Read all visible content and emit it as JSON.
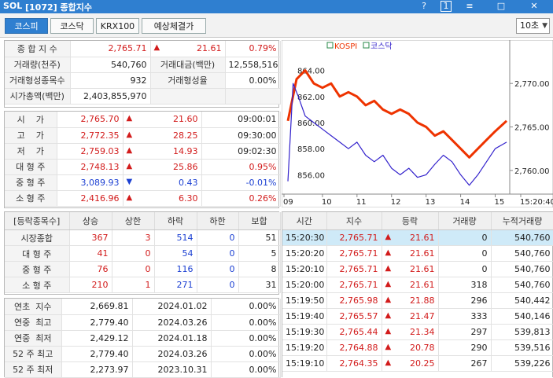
{
  "window": {
    "logo": "SOL",
    "title": "[1072] 종합지수",
    "buttons": [
      "?",
      "1",
      "≡",
      "□"
    ]
  },
  "tabs": [
    {
      "label": "코스피",
      "active": true
    },
    {
      "label": "코스닥",
      "active": false
    },
    {
      "label": "KRX100",
      "active": false
    },
    {
      "label": "예상체결가",
      "active": false
    }
  ],
  "interval": "10초",
  "summary": {
    "r1": {
      "label": "종 합 지 수",
      "value": "2,765.71",
      "change": "21.61",
      "pct": "0.79%"
    },
    "r2": {
      "label1": "거래량(천주)",
      "value1": "540,760",
      "label2": "거래대금(백만)",
      "value2": "12,558,516"
    },
    "r3": {
      "label1": "거래형성종목수",
      "value1": "932",
      "label2": "거래형성율",
      "value2": "0.00%"
    },
    "r4": {
      "label": "시가총액(백만)",
      "value": "2,403,855,970"
    }
  },
  "prices": [
    {
      "label": "시    가",
      "value": "2,765.70",
      "dir": "up",
      "change": "21.60",
      "extra": "09:00:01"
    },
    {
      "label": "고    가",
      "value": "2,772.35",
      "dir": "up",
      "change": "28.25",
      "extra": "09:30:00"
    },
    {
      "label": "저    가",
      "value": "2,759.03",
      "dir": "up",
      "change": "14.93",
      "extra": "09:02:30"
    },
    {
      "label": "대 형 주",
      "value": "2,748.13",
      "dir": "up",
      "change": "25.86",
      "extra": "0.95%"
    },
    {
      "label": "중 형 주",
      "value": "3,089.93",
      "dir": "down",
      "change": "0.43",
      "extra": "-0.01%"
    },
    {
      "label": "소 형 주",
      "value": "2,416.96",
      "dir": "up",
      "change": "6.30",
      "extra": "0.26%"
    }
  ],
  "breadth": {
    "headers": [
      "[등락종목수]",
      "상승",
      "상한",
      "하락",
      "하한",
      "보합"
    ],
    "rows": [
      {
        "label": "시장종합",
        "cells": [
          "367",
          "3",
          "514",
          "0",
          "51"
        ]
      },
      {
        "label": "대 형 주",
        "cells": [
          "41",
          "0",
          "54",
          "0",
          "5"
        ]
      },
      {
        "label": "중 형 주",
        "cells": [
          "76",
          "0",
          "116",
          "0",
          "8"
        ]
      },
      {
        "label": "소 형 주",
        "cells": [
          "210",
          "1",
          "271",
          "0",
          "31"
        ]
      }
    ]
  },
  "yearly": [
    {
      "label": "연초  지수",
      "value": "2,669.81",
      "date": "2024.01.02",
      "pct": "0.00%"
    },
    {
      "label": "연중  최고",
      "value": "2,779.40",
      "date": "2024.03.26",
      "pct": "0.00%"
    },
    {
      "label": "연중  최저",
      "value": "2,429.12",
      "date": "2024.01.18",
      "pct": "0.00%"
    },
    {
      "label": "52 주 최고",
      "value": "2,779.40",
      "date": "2024.03.26",
      "pct": "0.00%"
    },
    {
      "label": "52 주 최저",
      "value": "2,273.97",
      "date": "2023.10.31",
      "pct": "0.00%"
    }
  ],
  "ticks": {
    "headers": [
      "시간",
      "지수",
      "등락",
      "거래량",
      "누적거래량"
    ],
    "rows": [
      {
        "time": "15:20:30",
        "index": "2,765.71",
        "change": "21.61",
        "vol": "0",
        "cum": "540,760",
        "selected": true
      },
      {
        "time": "15:20:20",
        "index": "2,765.71",
        "change": "21.61",
        "vol": "0",
        "cum": "540,760",
        "selected": false
      },
      {
        "time": "15:20:10",
        "index": "2,765.71",
        "change": "21.61",
        "vol": "0",
        "cum": "540,760",
        "selected": false
      },
      {
        "time": "15:20:00",
        "index": "2,765.71",
        "change": "21.61",
        "vol": "318",
        "cum": "540,760",
        "selected": false
      },
      {
        "time": "15:19:50",
        "index": "2,765.98",
        "change": "21.88",
        "vol": "296",
        "cum": "540,442",
        "selected": false
      },
      {
        "time": "15:19:40",
        "index": "2,765.57",
        "change": "21.47",
        "vol": "333",
        "cum": "540,146",
        "selected": false
      },
      {
        "time": "15:19:30",
        "index": "2,765.44",
        "change": "21.34",
        "vol": "297",
        "cum": "539,813",
        "selected": false
      },
      {
        "time": "15:19:20",
        "index": "2,764.88",
        "change": "20.78",
        "vol": "290",
        "cum": "539,516",
        "selected": false
      },
      {
        "time": "15:19:10",
        "index": "2,764.35",
        "change": "20.25",
        "vol": "267",
        "cum": "539,226",
        "selected": false
      }
    ]
  },
  "chart_data": {
    "type": "line",
    "legend": [
      "KOSPI",
      "코스닥"
    ],
    "legend_placement": "top-left",
    "x_ticks": [
      "09",
      "10",
      "11",
      "12",
      "13",
      "14",
      "15",
      "15:20:40"
    ],
    "left_axis": {
      "ticks": [
        "864.00",
        "862.00",
        "860.00",
        "858.00",
        "856.00"
      ],
      "ylim": [
        855,
        865
      ]
    },
    "right_axis": {
      "ticks": [
        "2,770.00",
        "2,765.00",
        "2,760.00"
      ],
      "ylim": [
        2758,
        2773
      ]
    },
    "grid": false,
    "series": [
      {
        "name": "KOSPI",
        "color": "#ee3300",
        "axis": "right",
        "x": [
          9.0,
          9.25,
          9.5,
          9.75,
          10.0,
          10.25,
          10.5,
          10.75,
          11.0,
          11.25,
          11.5,
          11.75,
          12.0,
          12.25,
          12.5,
          12.75,
          13.0,
          13.25,
          13.5,
          13.75,
          14.0,
          14.25,
          14.5,
          14.75,
          15.0,
          15.33
        ],
        "y": [
          2765.7,
          2770.5,
          2771.5,
          2770.0,
          2769.5,
          2770.0,
          2768.5,
          2769.0,
          2768.5,
          2767.5,
          2768.0,
          2767.0,
          2766.5,
          2767.0,
          2766.5,
          2765.5,
          2765.0,
          2764.0,
          2764.5,
          2763.5,
          2762.5,
          2761.5,
          2762.5,
          2763.5,
          2764.5,
          2765.7
        ]
      },
      {
        "name": "코스닥",
        "color": "#3322cc",
        "axis": "left",
        "x": [
          9.0,
          9.15,
          9.3,
          9.5,
          9.75,
          10.0,
          10.25,
          10.5,
          10.75,
          11.0,
          11.25,
          11.5,
          11.75,
          12.0,
          12.25,
          12.5,
          12.75,
          13.0,
          13.25,
          13.5,
          13.75,
          14.0,
          14.25,
          14.5,
          14.75,
          15.0,
          15.33
        ],
        "y": [
          855.5,
          863.0,
          862.0,
          860.5,
          860.0,
          859.5,
          859.0,
          858.5,
          858.0,
          858.5,
          857.5,
          857.0,
          857.5,
          856.5,
          856.0,
          856.5,
          855.8,
          856.0,
          856.8,
          857.5,
          857.0,
          856.0,
          855.2,
          856.0,
          857.0,
          858.0,
          858.5
        ]
      }
    ]
  }
}
